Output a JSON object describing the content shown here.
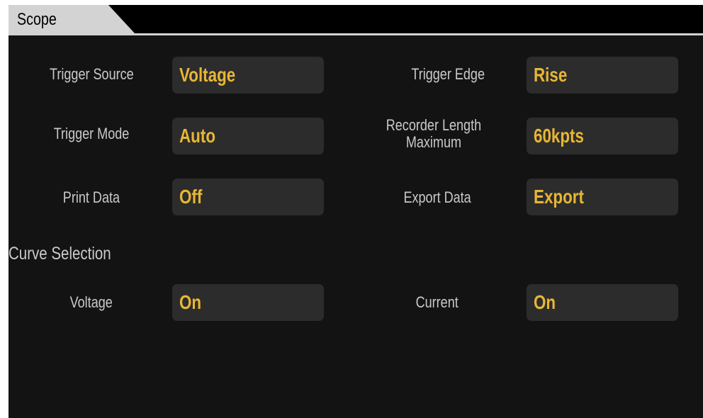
{
  "tab": {
    "title": "Scope"
  },
  "settings": [
    {
      "label": "Trigger Source",
      "value": "Voltage"
    },
    {
      "label": "Trigger Edge",
      "value": "Rise"
    },
    {
      "label": "Trigger Mode",
      "value": "Auto"
    },
    {
      "label": "Recorder Length\nMaximum",
      "value": "60kpts"
    },
    {
      "label": "Print Data",
      "value": "Off"
    },
    {
      "label": "Export Data",
      "value": "Export"
    }
  ],
  "curve_selection": {
    "title": "Curve Selection",
    "items": [
      {
        "label": "Voltage",
        "value": "On"
      },
      {
        "label": "Current",
        "value": "On"
      }
    ]
  },
  "colors": {
    "background": "#131313",
    "value_text": "#e8b634",
    "field_background": "#2c2c2c",
    "label_text": "#c9c9c9",
    "tab_background": "#d3d3d3"
  }
}
